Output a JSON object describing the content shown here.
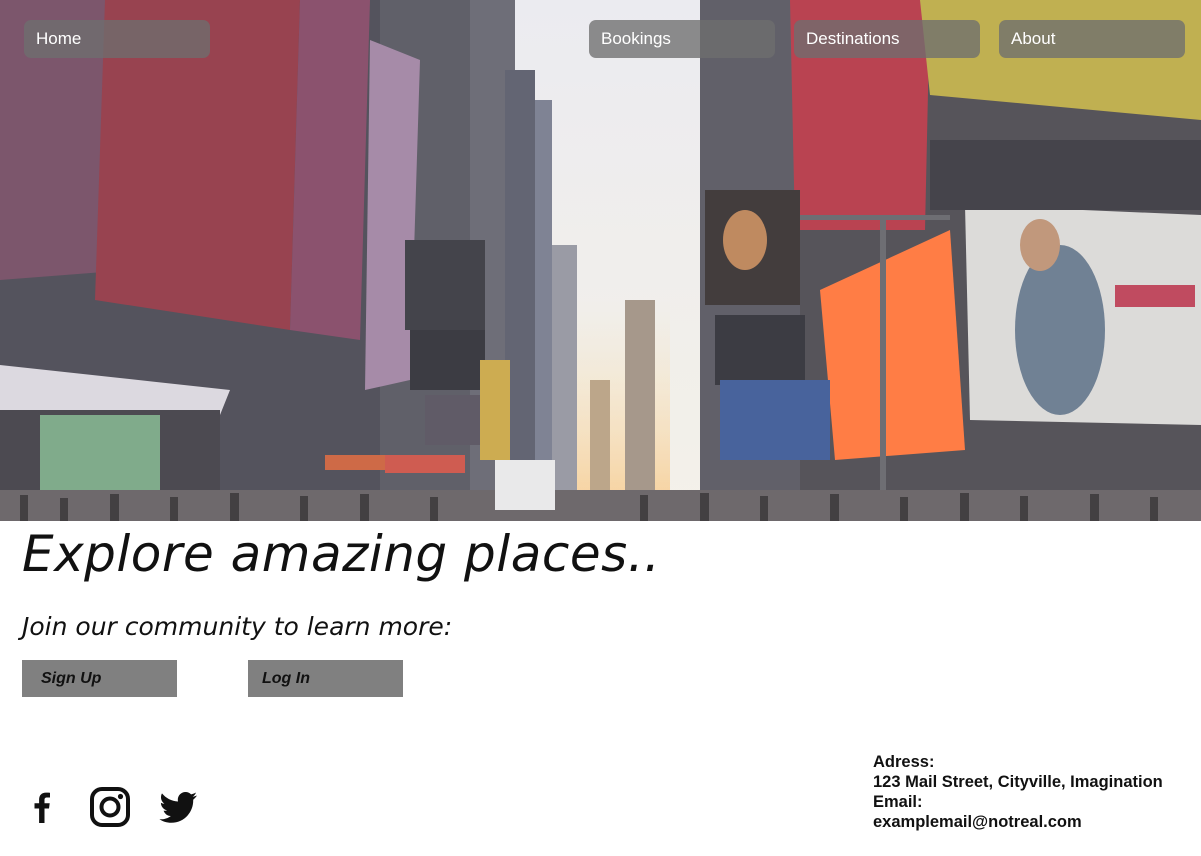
{
  "nav": {
    "home": "Home",
    "bookings": "Bookings",
    "destinations": "Destinations",
    "about": "About"
  },
  "hero": {
    "headline": "Explore amazing places..",
    "subline": "Join our community to learn more:"
  },
  "buttons": {
    "signup": "Sign Up",
    "login": "Log In"
  },
  "social": [
    "facebook-icon",
    "instagram-icon",
    "twitter-icon"
  ],
  "contact": {
    "address_label": "Adress:",
    "address_value": "123 Mail Street, Cityville, Imagination",
    "email_label": "Email:",
    "email_value": "examplemail@notreal.com"
  },
  "colors": {
    "nav_pill": "#6e6e6e",
    "button": "#808080",
    "text": "#111111"
  }
}
